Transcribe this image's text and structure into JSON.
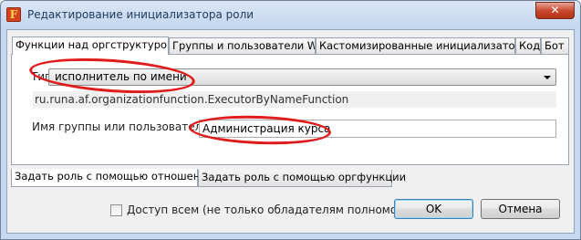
{
  "window": {
    "title": "Редактирование инициализатора роли",
    "app_icon_letter": "F",
    "close_glyph": "✕"
  },
  "tabs": [
    {
      "label": "Функции над оргструктурой"
    },
    {
      "label": "Группы и пользователи WF"
    },
    {
      "label": "Кастомизированные инициализаторы"
    },
    {
      "label": "Код"
    },
    {
      "label": "Бот"
    }
  ],
  "selected_tab": "Функции над оргструктурой",
  "form": {
    "type_label": "Тип",
    "type_value": "исполнитель по имени",
    "function_class": "ru.runa.af.organizationfunction.ExecutorByNameFunction",
    "group_user_label": "Имя группы или пользователя *",
    "group_user_value": "Администрация курса"
  },
  "bottom_tabs": [
    {
      "label": "Задать роль с помощью отношения"
    },
    {
      "label": "Задать роль с помощью оргфункции"
    }
  ],
  "selected_bottom_tab": "Задать роль с помощью отношения",
  "footer": {
    "access_all_label": "Доступ всем (не только обладателям полномочий)",
    "access_all_checked": false,
    "ok_label": "OK",
    "cancel_label": "Отмена"
  },
  "annotations": {
    "highlight_color": "#e01b1b"
  }
}
